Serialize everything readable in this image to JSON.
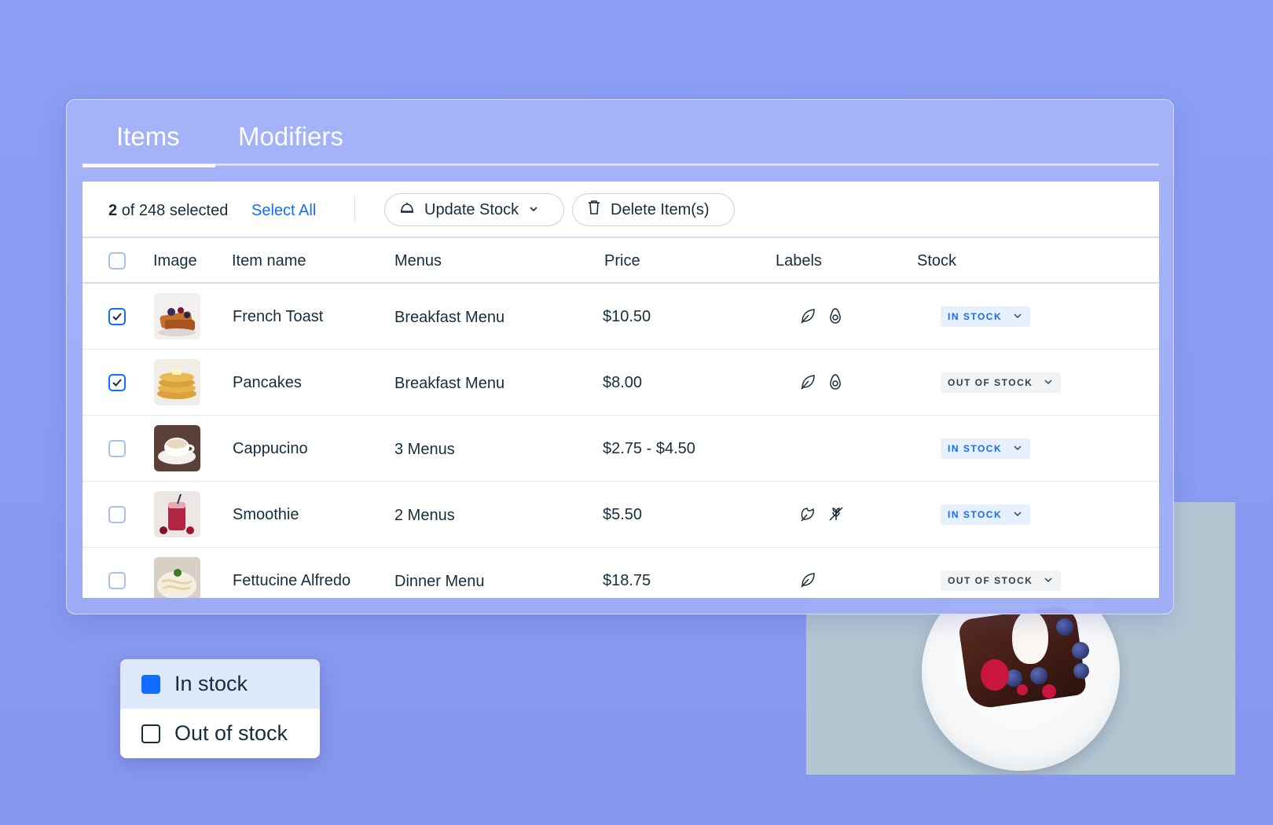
{
  "tabs": [
    {
      "label": "Items",
      "active": true
    },
    {
      "label": "Modifiers",
      "active": false
    }
  ],
  "toolbar": {
    "selection_count": "2",
    "selection_text": "of 248 selected",
    "select_all_label": "Select All",
    "update_stock_label": "Update Stock",
    "delete_label": "Delete Item(s)"
  },
  "columns": [
    "Image",
    "Item name",
    "Menus",
    "Price",
    "Labels",
    "Stock"
  ],
  "rows": [
    {
      "checked": true,
      "image": "french-toast",
      "name": "French Toast",
      "menus": "Breakfast Menu",
      "price": "$10.50",
      "labels": [
        "leaf-icon",
        "avocado-icon"
      ],
      "stock": "IN STOCK",
      "in_stock": true
    },
    {
      "checked": true,
      "image": "pancakes",
      "name": "Pancakes",
      "menus": "Breakfast Menu",
      "price": "$8.00",
      "labels": [
        "leaf-icon",
        "avocado-icon"
      ],
      "stock": "OUT OF STOCK",
      "in_stock": false
    },
    {
      "checked": false,
      "image": "cappucino",
      "name": "Cappucino",
      "menus": "3 Menus",
      "price": "$2.75 - $4.50",
      "labels": [],
      "stock": "IN STOCK",
      "in_stock": true
    },
    {
      "checked": false,
      "image": "smoothie",
      "name": "Smoothie",
      "menus": "2 Menus",
      "price": "$5.50",
      "labels": [
        "heart-leaf-icon",
        "gluten-free-icon"
      ],
      "stock": "IN STOCK",
      "in_stock": true
    },
    {
      "checked": false,
      "image": "fettucine",
      "name": "Fettucine Alfredo",
      "menus": "Dinner Menu",
      "price": "$18.75",
      "labels": [
        "leaf-icon"
      ],
      "stock": "OUT OF STOCK",
      "in_stock": false
    }
  ],
  "stock_dropdown": {
    "options": [
      {
        "label": "In stock",
        "selected": true
      },
      {
        "label": "Out of stock",
        "selected": false
      }
    ]
  },
  "colors": {
    "accent": "#116dff",
    "background": "#8b9ef4",
    "in_stock_bg": "#e7f0ff",
    "out_stock_bg": "#f1f3f5"
  }
}
